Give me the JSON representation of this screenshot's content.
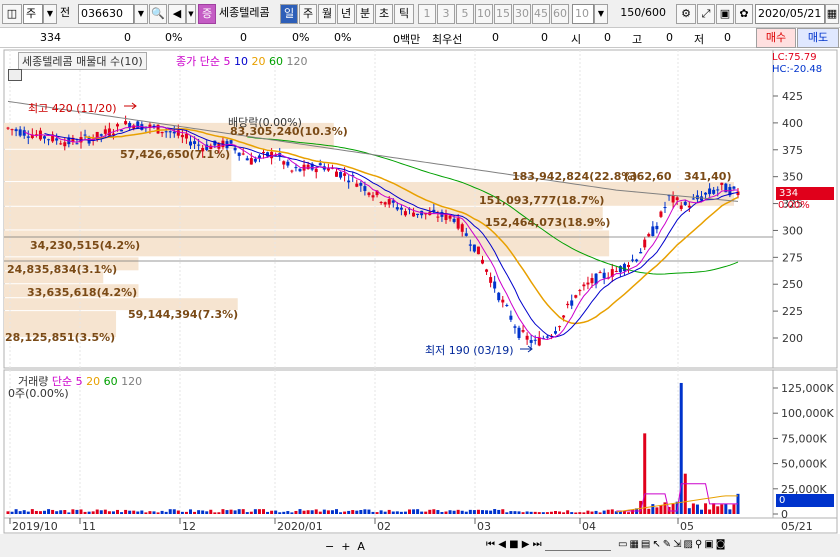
{
  "toolbar": {
    "market": "주",
    "prev": "전",
    "code": "036630",
    "badge": "증",
    "name": "세종텔레콤",
    "periods": [
      "일",
      "주",
      "월",
      "년",
      "분",
      "초",
      "틱"
    ],
    "numbers": [
      "1",
      "3",
      "5",
      "10",
      "15",
      "30",
      "45",
      "60"
    ],
    "interval": "10",
    "count": "150",
    "total": "/600",
    "date": "2020/05/21"
  },
  "info": {
    "price": "334",
    "v1": "0",
    "pct1": "0%",
    "v2": "0",
    "pct2": "0%",
    "v3": "0%",
    "amount": "0백만",
    "bid_label": "최우선",
    "b1": "0",
    "b2": "0",
    "open_label": "시",
    "open": "0",
    "high_label": "고",
    "high": "0",
    "low_label": "저",
    "low": "0",
    "buy": "매수",
    "sell": "매도"
  },
  "price_panel": {
    "title": "세종텔레콤 매물대 수(10)",
    "ma_label": "종가 단순",
    "ma": [
      "5",
      "10",
      "20",
      "60",
      "120"
    ],
    "lc": "LC:75.79",
    "hc": "HC:-20.48",
    "high_note": "최고 420 (11/20)",
    "low_note": "최저 190 (03/19)",
    "div_note": "배당락(0.00%)",
    "current": "334",
    "current_pct": "0.00%",
    "yaxis": [
      "425",
      "400",
      "375",
      "350",
      "325",
      "300",
      "275",
      "250",
      "225",
      "200"
    ],
    "profile": [
      {
        "text": "28,125,851(3.5%)",
        "pct": 3.5
      },
      {
        "text": "59,144,394(7.3%)",
        "pct": 7.3
      },
      {
        "text": "33,635,618(4.2%)",
        "pct": 4.2
      },
      {
        "text": "24,835,834(3.1%)",
        "pct": 3.1
      },
      {
        "text": "34,230,515(4.2%)",
        "pct": 4.2
      },
      {
        "text": "152,464,073(18.9%)",
        "pct": 18.9
      },
      {
        "text": "151,093,777(18.7%)",
        "pct": 18.7
      },
      {
        "text": "183,942,824(22.8%)",
        "pct": 22.8
      },
      {
        "text": "57,426,650(7.1%)",
        "pct": 7.1
      },
      {
        "text": "83,305,240(10.3%)",
        "pct": 10.3
      }
    ],
    "hl_left": "(362,60",
    "hl_right": "341,40)"
  },
  "volume_panel": {
    "title": "거래량",
    "ma_label": "단순",
    "ma": [
      "5",
      "20",
      "60",
      "120"
    ],
    "value": "0주(0.00%)",
    "yaxis": [
      "125,000K",
      "100,000K",
      "75,000K",
      "50,000K",
      "25,000K",
      "0"
    ],
    "current": "0"
  },
  "xaxis": [
    "2019/10",
    "11",
    "12",
    "2020/01",
    "02",
    "03",
    "04",
    "05"
  ],
  "xaxis_right": "05/21",
  "colors": {
    "up": "#e0001b",
    "down": "#0033cc",
    "ma5": "#cc00cc",
    "ma10": "#0000cc",
    "ma20": "#e8a000",
    "ma60": "#00a000",
    "ma120": "#808080",
    "profile": "#f6e4d0"
  }
}
